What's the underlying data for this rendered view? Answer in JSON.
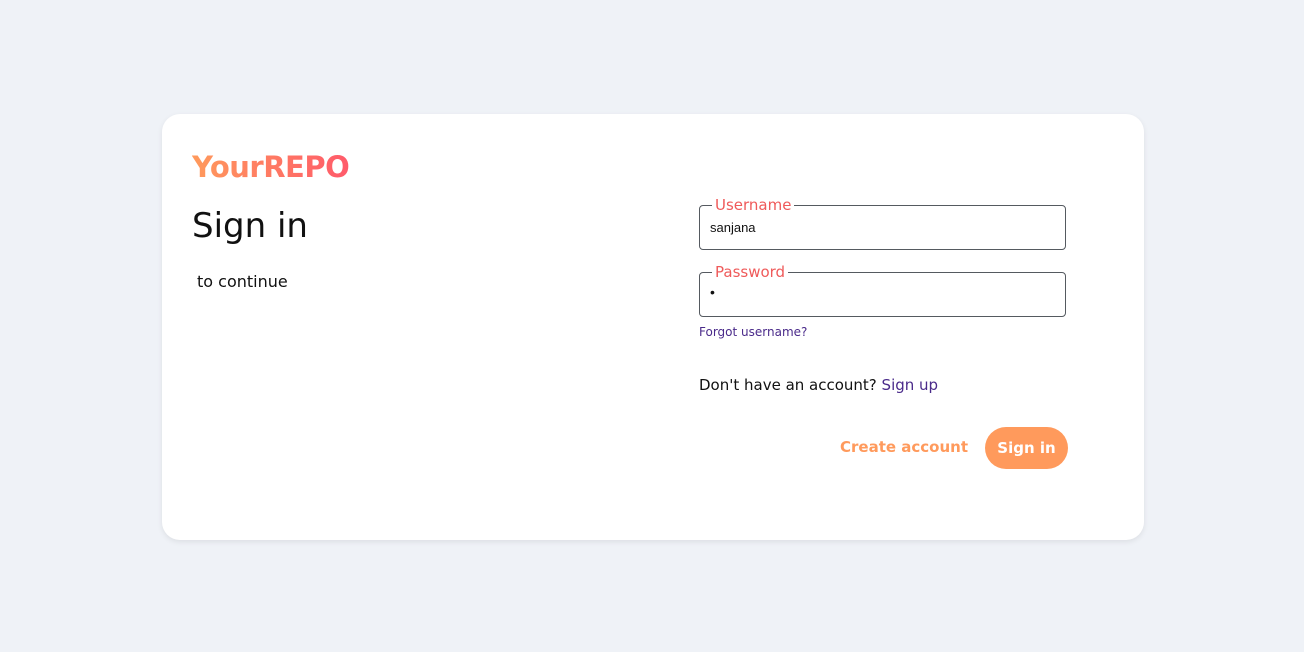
{
  "brand": {
    "logo_text": "YourREPO",
    "gradient_start": "#ff9a5c",
    "gradient_end": "#ff5a6a"
  },
  "page": {
    "title": "Sign in",
    "subtitle": "to continue"
  },
  "form": {
    "username": {
      "label": "Username",
      "value": "sanjana"
    },
    "password": {
      "label": "Password",
      "value": "•"
    },
    "forgot_link": "Forgot username?",
    "signup_prompt": "Don't have an account?",
    "signup_link": "Sign up",
    "create_account_label": "Create account",
    "signin_label": "Sign in"
  },
  "colors": {
    "accent": "#ff9a5c",
    "label": "#ef5a5a",
    "link": "#4a2a8a",
    "background": "#eff2f7"
  }
}
